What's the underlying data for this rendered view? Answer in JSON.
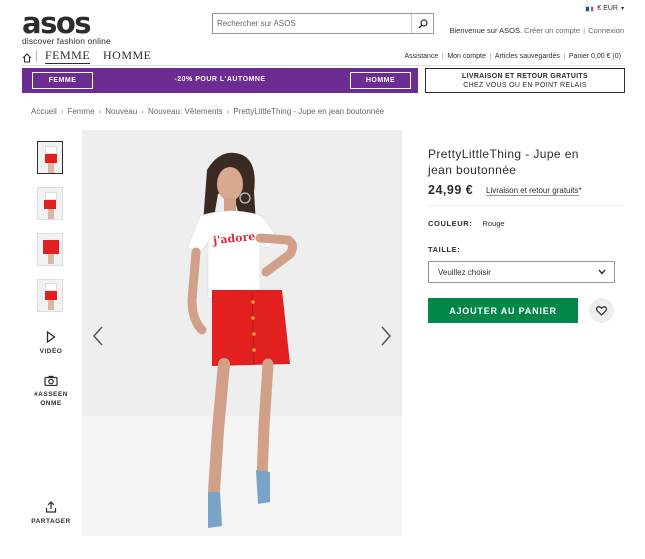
{
  "header": {
    "logo_word": "asos",
    "logo_tagline": "discover fashion online",
    "search_placeholder": "Rechercher sur ASOS",
    "locale": {
      "currency": "€ EUR",
      "flag_colors": [
        "#0055a4",
        "#ffffff",
        "#ef4135"
      ]
    },
    "welcome": {
      "text": "Bienvenue sur ASOS.",
      "create_account": "Créer un compte",
      "separator": "|",
      "login": "Connexion"
    }
  },
  "nav": {
    "tabs": [
      {
        "label": "FEMME"
      },
      {
        "label": "HOMME"
      }
    ],
    "utility": [
      "Assistance",
      "Mon compte",
      "Articles sauvegardés",
      "Panier 0,00 € (0)"
    ]
  },
  "promo": {
    "left_button": "FEMME",
    "text": "-20% POUR L'AUTOMNE",
    "right_button": "HOMME",
    "background": "#6c2c91"
  },
  "delivery": {
    "line1": "LIVRAISON ET RETOUR GRATUITS",
    "line2": "CHEZ VOUS OU EN POINT RELAIS"
  },
  "breadcrumb": [
    "Accueil",
    "Femme",
    "Nouveau",
    "Nouveau: Vêtements",
    "PrettyLittleThing - Jupe en jean boutonnée"
  ],
  "gallery": {
    "video_label": "VIDÉO",
    "asseen_line1": "#ASSEEN",
    "asseen_line2": "ONME",
    "share_label": "PARTAGER",
    "tshirt_text": "j'adore"
  },
  "product": {
    "title": "PrettyLittleThing - Jupe en jean boutonnée",
    "price": "24,99 €",
    "shipping": "Livraison et retour gratuits",
    "shipping_mark": "*",
    "color_label": "COULEUR:",
    "color_value": "Rouge",
    "size_label": "TAILLE:",
    "size_value": "Veuillez choisir",
    "add_to_cart": "AJOUTER AU PANIER",
    "accent_color": "#018849"
  }
}
